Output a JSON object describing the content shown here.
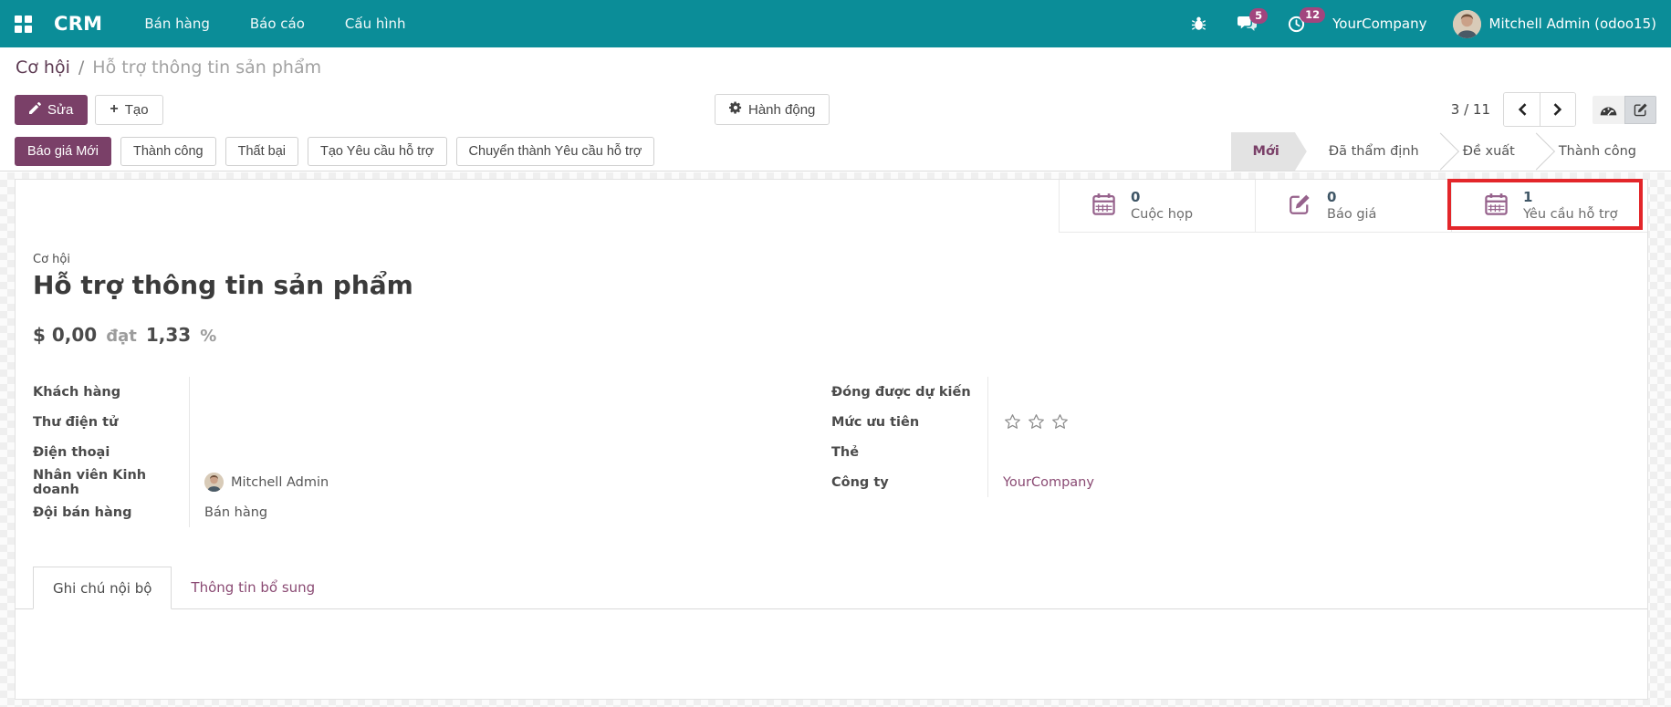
{
  "topbar": {
    "brand": "CRM",
    "menu": [
      {
        "label": "Bán hàng"
      },
      {
        "label": "Báo cáo"
      },
      {
        "label": "Cấu hình"
      }
    ],
    "messages_badge": "5",
    "activities_badge": "12",
    "company": "YourCompany",
    "user": "Mitchell Admin (odoo15)"
  },
  "breadcrumb": {
    "parent": "Cơ hội",
    "separator": "/",
    "current": "Hỗ trợ thông tin sản phẩm"
  },
  "controls": {
    "edit": "Sửa",
    "create": "Tạo",
    "create_icon": "+",
    "action": "Hành động",
    "pager": "3 / 11"
  },
  "statusbar": {
    "buttons": [
      {
        "label": "Báo giá Mới",
        "active": true
      },
      {
        "label": "Thành công",
        "active": false
      },
      {
        "label": "Thất bại",
        "active": false
      },
      {
        "label": "Tạo Yêu cầu hỗ trợ",
        "active": false
      },
      {
        "label": "Chuyển thành Yêu cầu hỗ trợ",
        "active": false
      }
    ],
    "stages": [
      {
        "label": "Mới",
        "active": true
      },
      {
        "label": "Đã thẩm định",
        "active": false
      },
      {
        "label": "Đề xuất",
        "active": false
      },
      {
        "label": "Thành công",
        "active": false
      }
    ]
  },
  "smart_buttons": [
    {
      "icon": "calendar-icon",
      "value": "0",
      "label": "Cuộc họp",
      "highlighted": false
    },
    {
      "icon": "quotation-icon",
      "value": "0",
      "label": "Báo giá",
      "highlighted": false
    },
    {
      "icon": "calendar-icon",
      "value": "1",
      "label": "Yêu cầu hỗ trợ",
      "highlighted": true
    }
  ],
  "sheet": {
    "type_label": "Cơ hội",
    "title": "Hỗ trợ thông tin sản phẩm",
    "revenue": {
      "currency_amount": "$ 0,00",
      "connector": "đạt",
      "probability": "1,33",
      "unit": "%"
    },
    "fields_left": [
      {
        "label": "Khách hàng",
        "value": ""
      },
      {
        "label": "Thư điện tử",
        "value": ""
      },
      {
        "label": "Điện thoại",
        "value": ""
      },
      {
        "label": "Nhân viên Kinh doanh",
        "value": "Mitchell Admin"
      },
      {
        "label": "Đội bán hàng",
        "value": "Bán hàng"
      }
    ],
    "fields_right": [
      {
        "label": "Đóng được dự kiến",
        "value": ""
      },
      {
        "label": "Mức ưu tiên",
        "value": "",
        "stars": 3
      },
      {
        "label": "Thẻ",
        "value": ""
      },
      {
        "label": "Công ty",
        "value": "YourCompany"
      }
    ],
    "tabs": [
      {
        "label": "Ghi chú nội bộ",
        "active": true
      },
      {
        "label": "Thông tin bổ sung",
        "active": false
      }
    ]
  },
  "colors": {
    "topbar_teal": "#0b8d98",
    "primary_purple": "#7a4068",
    "link_purple": "#8a4a73",
    "badge_pink": "#a2457e",
    "annotation_red": "#e3262a",
    "smart_icon_purple": "#96628c"
  }
}
